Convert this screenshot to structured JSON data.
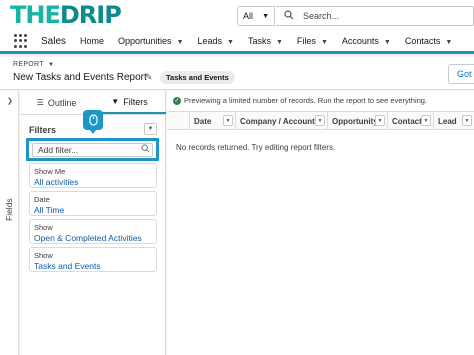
{
  "header": {
    "logo_part1": "THE",
    "logo_part2": "DRIP",
    "search_scope": "All",
    "search_placeholder": "Search..."
  },
  "nav": {
    "app_name": "Sales",
    "items": [
      {
        "label": "Home",
        "has_menu": false
      },
      {
        "label": "Opportunities",
        "has_menu": true
      },
      {
        "label": "Leads",
        "has_menu": true
      },
      {
        "label": "Tasks",
        "has_menu": true
      },
      {
        "label": "Files",
        "has_menu": true
      },
      {
        "label": "Accounts",
        "has_menu": true
      },
      {
        "label": "Contacts",
        "has_menu": true
      }
    ]
  },
  "report": {
    "label": "REPORT",
    "title": "New Tasks and Events Report",
    "type_pill": "Tasks and Events",
    "button_partial": "Got I"
  },
  "sidebar": {
    "fields_label": "Fields",
    "tab_outline": "Outline",
    "tab_filters": "Filters",
    "filters_title": "Filters",
    "add_filter_placeholder": "Add filter...",
    "filters": [
      {
        "label": "Show Me",
        "value": "All activities"
      },
      {
        "label": "Date",
        "value": "All Time"
      },
      {
        "label": "Show",
        "value": "Open & Completed Activities"
      },
      {
        "label": "Show",
        "value": "Tasks and Events"
      }
    ]
  },
  "preview": {
    "notice": "Previewing a limited number of records. Run the report to see everything.",
    "columns": [
      "Date",
      "Company / Account",
      "Opportunity",
      "Contact",
      "Lead"
    ],
    "empty_message": "No records returned. Try editing report filters."
  },
  "colors": {
    "brand_teal": "#17b4a4",
    "nav_accent": "#1b96a8",
    "highlight_blue": "#1b96c8",
    "link_blue": "#0b5cab"
  }
}
